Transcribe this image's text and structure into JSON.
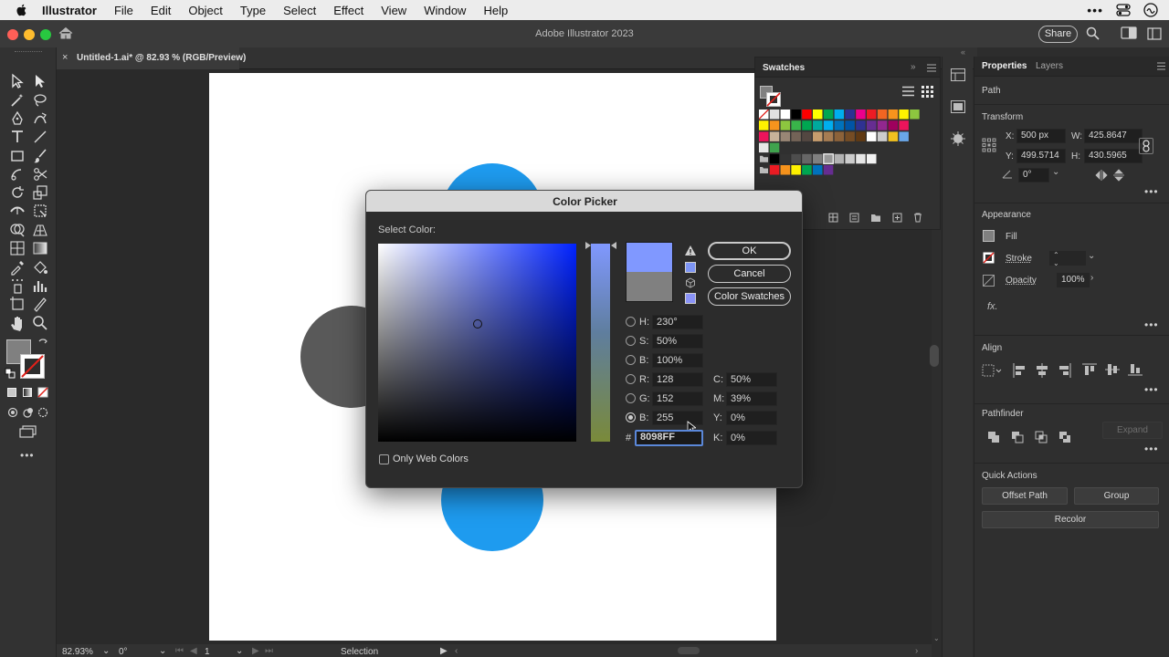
{
  "menubar": {
    "app": "Illustrator",
    "items": [
      "File",
      "Edit",
      "Object",
      "Type",
      "Select",
      "Effect",
      "View",
      "Window",
      "Help"
    ]
  },
  "window": {
    "title": "Adobe Illustrator 2023",
    "share_label": "Share"
  },
  "document_tab": {
    "title": "Untitled-1.ai* @ 82.93 % (RGB/Preview)",
    "close": "×"
  },
  "swatches": {
    "title": "Swatches"
  },
  "properties": {
    "tabs": [
      "Properties",
      "Layers"
    ],
    "object_type": "Path",
    "transform": {
      "title": "Transform",
      "x": "500 px",
      "y": "499.5714",
      "w": "425.8647",
      "h": "430.5965",
      "angle": "0°",
      "labels": {
        "x": "X:",
        "y": "Y:",
        "w": "W:",
        "h": "H:"
      }
    },
    "appearance": {
      "title": "Appearance",
      "fill": "Fill",
      "stroke": "Stroke",
      "opacity": "Opacity",
      "opacity_value": "100%",
      "fx": "fx."
    },
    "align": {
      "title": "Align"
    },
    "pathfinder": {
      "title": "Pathfinder",
      "expand": "Expand"
    },
    "quick_actions": {
      "title": "Quick Actions",
      "offset_path": "Offset Path",
      "group": "Group",
      "recolor": "Recolor"
    }
  },
  "color_picker": {
    "title": "Color Picker",
    "select_color": "Select Color:",
    "ok": "OK",
    "cancel": "Cancel",
    "color_swatches": "Color Swatches",
    "fields": {
      "h": {
        "label": "H:",
        "value": "230°"
      },
      "s": {
        "label": "S:",
        "value": "50%"
      },
      "b": {
        "label": "B:",
        "value": "100%"
      },
      "r": {
        "label": "R:",
        "value": "128"
      },
      "g": {
        "label": "G:",
        "value": "152"
      },
      "bb": {
        "label": "B:",
        "value": "255"
      },
      "hex": {
        "label": "#",
        "value": "8098FF"
      },
      "c": {
        "label": "C:",
        "value": "50%"
      },
      "m": {
        "label": "M:",
        "value": "39%"
      },
      "y": {
        "label": "Y:",
        "value": "0%"
      },
      "k": {
        "label": "K:",
        "value": "0%"
      }
    },
    "only_web_colors": "Only Web Colors",
    "new_color": "#8098FF",
    "old_color": "#808080"
  },
  "statusbar": {
    "zoom": "82.93%",
    "rotation": "0°",
    "artboard": "1",
    "tool": "Selection"
  },
  "colors": {
    "circle_blue": "#1E9BEF",
    "circle_gray": "#595959",
    "accent": "#8098FF"
  }
}
